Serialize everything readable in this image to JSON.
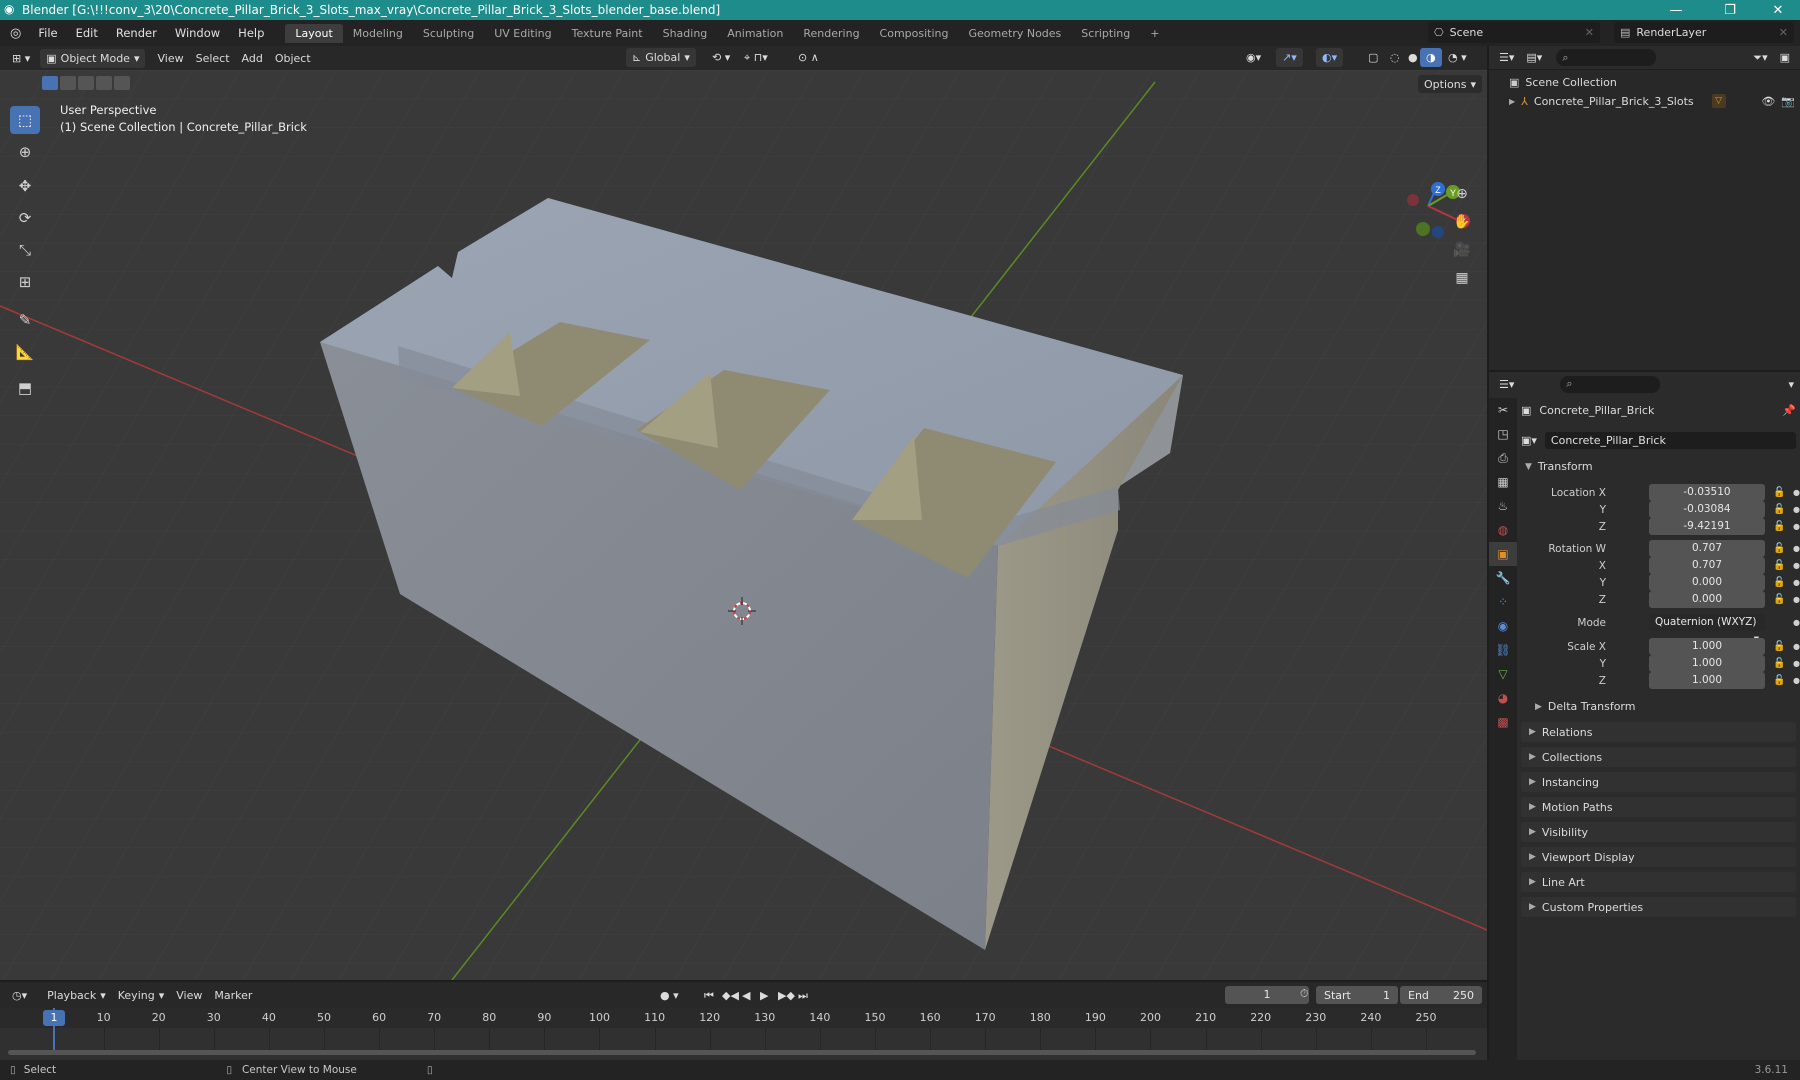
{
  "window": {
    "title": "Blender [G:\\!!!conv_3\\20\\Concrete_Pillar_Brick_3_Slots_max_vray\\Concrete_Pillar_Brick_3_Slots_blender_base.blend]",
    "controls": [
      "—",
      "❐",
      "✕"
    ]
  },
  "menu": [
    "File",
    "Edit",
    "Render",
    "Window",
    "Help"
  ],
  "workspaces": [
    "Layout",
    "Modeling",
    "Sculpting",
    "UV Editing",
    "Texture Paint",
    "Shading",
    "Animation",
    "Rendering",
    "Compositing",
    "Geometry Nodes",
    "Scripting",
    "+"
  ],
  "scene": {
    "label": "Scene",
    "render_layer": "RenderLayer"
  },
  "viewport_header": {
    "mode": "Object Mode",
    "menus": [
      "View",
      "Select",
      "Add",
      "Object"
    ],
    "orientation": "Global",
    "options": "Options"
  },
  "viewport": {
    "view_name": "User Perspective",
    "collection_info": "(1) Scene Collection | Concrete_Pillar_Brick",
    "gizmo_axes": [
      "Z",
      "Y",
      "X"
    ]
  },
  "outliner": {
    "root": "Scene Collection",
    "item": "Concrete_Pillar_Brick_3_Slots"
  },
  "properties": {
    "object_name": "Concrete_Pillar_Brick",
    "datablock_name": "Concrete_Pillar_Brick",
    "transform_header": "Transform",
    "location": {
      "label": "Location X",
      "x": "-0.03510",
      "y": "-0.03084",
      "z": "-9.42191"
    },
    "rotation": {
      "label": "Rotation W",
      "w": "0.707",
      "x": "0.707",
      "y": "0.000",
      "z": "0.000"
    },
    "mode_label": "Mode",
    "mode_value": "Quaternion (WXYZ)",
    "scale": {
      "label": "Scale X",
      "x": "1.000",
      "y": "1.000",
      "z": "1.000"
    },
    "axis_labels": {
      "x": "X",
      "y": "Y",
      "z": "Z"
    },
    "delta": "Delta Transform",
    "panels": [
      "Relations",
      "Collections",
      "Instancing",
      "Motion Paths",
      "Visibility",
      "Viewport Display",
      "Line Art",
      "Custom Properties"
    ]
  },
  "timeline": {
    "menus": [
      "Playback",
      "Keying",
      "View",
      "Marker"
    ],
    "current_frame": "1",
    "start_label": "Start",
    "start": "1",
    "end_label": "End",
    "end": "250",
    "frames": [
      "1",
      "10",
      "20",
      "30",
      "40",
      "50",
      "60",
      "70",
      "80",
      "90",
      "100",
      "110",
      "120",
      "130",
      "140",
      "150",
      "160",
      "170",
      "180",
      "190",
      "200",
      "210",
      "220",
      "230",
      "240",
      "250"
    ]
  },
  "status": {
    "select": "Select",
    "center": "Center View to Mouse",
    "version": "3.6.11"
  },
  "colors": {
    "accent": "#4772b3",
    "title_bar": "#1f8c8c",
    "x_axis": "#b5363f",
    "y_axis": "#6a9c25",
    "z_axis": "#2e6fd6",
    "object_orange": "#e0902a"
  }
}
